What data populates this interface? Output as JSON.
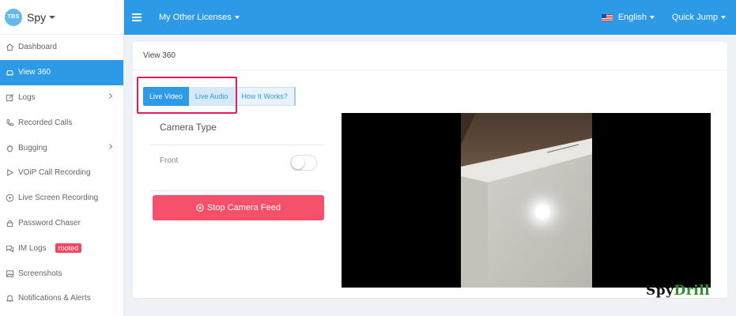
{
  "brand": {
    "logo_text": "TBS",
    "name": "Spy"
  },
  "header": {
    "licenses_label": "My Other Licenses",
    "language_label": "English",
    "quick_jump_label": "Quick Jump"
  },
  "sidebar": {
    "items": [
      {
        "label": "Dashboard",
        "icon": "home-icon"
      },
      {
        "label": "View 360",
        "icon": "car-icon",
        "active": true
      },
      {
        "label": "Logs",
        "icon": "edit-icon",
        "has_chevron": true
      },
      {
        "label": "Recorded Calls",
        "icon": "phone-icon"
      },
      {
        "label": "Bugging",
        "icon": "bug-icon",
        "has_chevron": true
      },
      {
        "label": "VOiP Call Recording",
        "icon": "play-icon"
      },
      {
        "label": "Live Screen Recording",
        "icon": "play-circle-icon"
      },
      {
        "label": "Password Chaser",
        "icon": "lock-icon"
      },
      {
        "label": "IM Logs",
        "icon": "chat-icon",
        "badge": "rooted"
      },
      {
        "label": "Screenshots",
        "icon": "image-icon"
      },
      {
        "label": "Notifications & Alerts",
        "icon": "bell-icon"
      }
    ]
  },
  "card": {
    "title": "View 360",
    "tabs": [
      "Live Video",
      "Live Audio",
      "How It Works?"
    ],
    "camera_type_label": "Camera Type",
    "front_label": "Front",
    "front_toggle_on": false,
    "stop_button_label": "Stop Camera Feed"
  },
  "watermark": {
    "part1": "Spy",
    "part2": "Drill"
  },
  "colors": {
    "primary": "#2d9ae8",
    "danger": "#f4506a",
    "highlight": "#e41b57",
    "badge": "#f0465f"
  }
}
